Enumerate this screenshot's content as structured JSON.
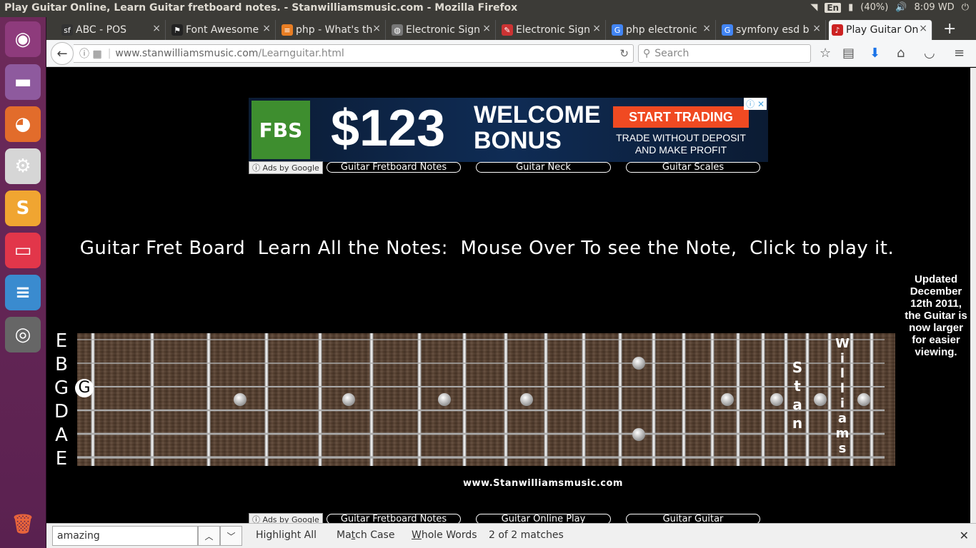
{
  "os": {
    "window_title": "Play Guitar Online, Learn Guitar fretboard notes. - Stanwilliamsmusic.com - Mozilla Firefox",
    "keyboard_layout": "En",
    "battery": "(40%)",
    "time": "8:09 WD"
  },
  "launcher": {
    "items": [
      {
        "name": "ubuntu-dash-icon",
        "glyph": "◉",
        "color": "#8e3b7c"
      },
      {
        "name": "files-icon",
        "glyph": "▬",
        "color": "#8e5a9e"
      },
      {
        "name": "firefox-icon",
        "glyph": "◕",
        "color": "#e26c2b"
      },
      {
        "name": "system-settings-icon",
        "glyph": "⚙",
        "color": "#d6d6d6"
      },
      {
        "name": "sublime-text-icon",
        "glyph": "S",
        "color": "#f0a531"
      },
      {
        "name": "app-icon",
        "glyph": "▭",
        "color": "#e2364a"
      },
      {
        "name": "text-editor-icon",
        "glyph": "≡",
        "color": "#3a8bcf"
      },
      {
        "name": "disk-utility-icon",
        "glyph": "◎",
        "color": "#666"
      }
    ],
    "trash_glyph": "🗑"
  },
  "tabs": [
    {
      "label": "ABC - POS",
      "favicon": "sf",
      "color": "#333"
    },
    {
      "label": "Font Awesome",
      "favicon": "⚑",
      "color": "#222"
    },
    {
      "label": "php - What's th",
      "favicon": "≡",
      "color": "#e87e24"
    },
    {
      "label": "Electronic Sign",
      "favicon": "◍",
      "color": "#777"
    },
    {
      "label": "Electronic Sign",
      "favicon": "✎",
      "color": "#c33"
    },
    {
      "label": "php electronic",
      "favicon": "G",
      "color": "#4285f4"
    },
    {
      "label": "symfony esd b",
      "favicon": "G",
      "color": "#4285f4"
    },
    {
      "label": "Play Guitar On",
      "favicon": "♪",
      "color": "#c22"
    }
  ],
  "nav": {
    "url_host": "www.stanwilliamsmusic.com",
    "url_path": "/Learnguitar.html",
    "search_placeholder": "Search"
  },
  "ad": {
    "brand": "FBS",
    "amount": "$123",
    "welcome_line1": "WELCOME",
    "welcome_line2": "BONUS",
    "cta": "START TRADING",
    "sub_line1": "TRADE WITHOUT DEPOSIT",
    "sub_line2": "AND MAKE PROFIT",
    "adchoices": "ⓘ ✕"
  },
  "adlinks_top": {
    "ads_by": "ⓘ Ads by Google",
    "links": [
      "Guitar Fretboard Notes",
      "Guitar Neck",
      "Guitar Scales"
    ]
  },
  "adlinks_bottom": {
    "ads_by": "ⓘ Ads by Google",
    "links": [
      "Guitar Fretboard Notes",
      "Guitar Online Play",
      "Guitar Guitar"
    ]
  },
  "page": {
    "headline": "Guitar Fret Board  Learn All the Notes:  Mouse Over To see the Note,  Click to play it.",
    "updated_note": "Updated December 12th 2011, the Guitar is now larger for easier viewing.",
    "string_names": [
      "E",
      "B",
      "G",
      "D",
      "A",
      "E"
    ],
    "highlighted_note": "G",
    "neck_text_1": "Stan",
    "neck_text_2": "Williams",
    "site_url": "www.Stanwilliamsmusic.com"
  },
  "findbar": {
    "query": "amazing",
    "highlight_all": "Highlight All",
    "match_case": "Match Case",
    "whole_words": "Whole Words",
    "match_status": "2 of 2 matches"
  }
}
